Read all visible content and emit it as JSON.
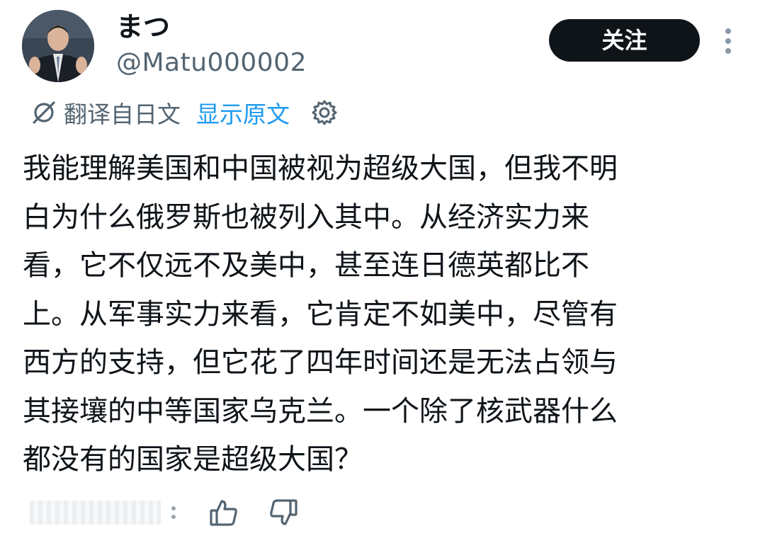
{
  "post": {
    "author": {
      "display_name": "まつ",
      "handle": "@Matu000002"
    },
    "follow_label": "关注",
    "translation": {
      "label": "翻译自日文",
      "show_original_label": "显示原文"
    },
    "body_lines": [
      "我能理解美国和中国被视为超级大国，但我不明",
      "白为什么俄罗斯也被列入其中。从经济实力来",
      "看，它不仅远不及美中，甚至连日德英都比不",
      "上。从军事实力来看，它肯定不如美中，尽管有",
      "西方的支持，但它花了四年时间还是无法占领与",
      "其接壤的中等国家乌克兰。一个除了核武器什么",
      "都没有的国家是超级大国？"
    ]
  },
  "icons": {
    "more": "more-vertical-icon",
    "translate": "translate-icon",
    "settings": "gear-icon",
    "like": "thumbs-up-icon",
    "dislike": "thumbs-down-icon"
  },
  "colors": {
    "follow_button_bg": "#0f1419",
    "link_blue": "#1d9bf0",
    "secondary_text": "#536471"
  }
}
